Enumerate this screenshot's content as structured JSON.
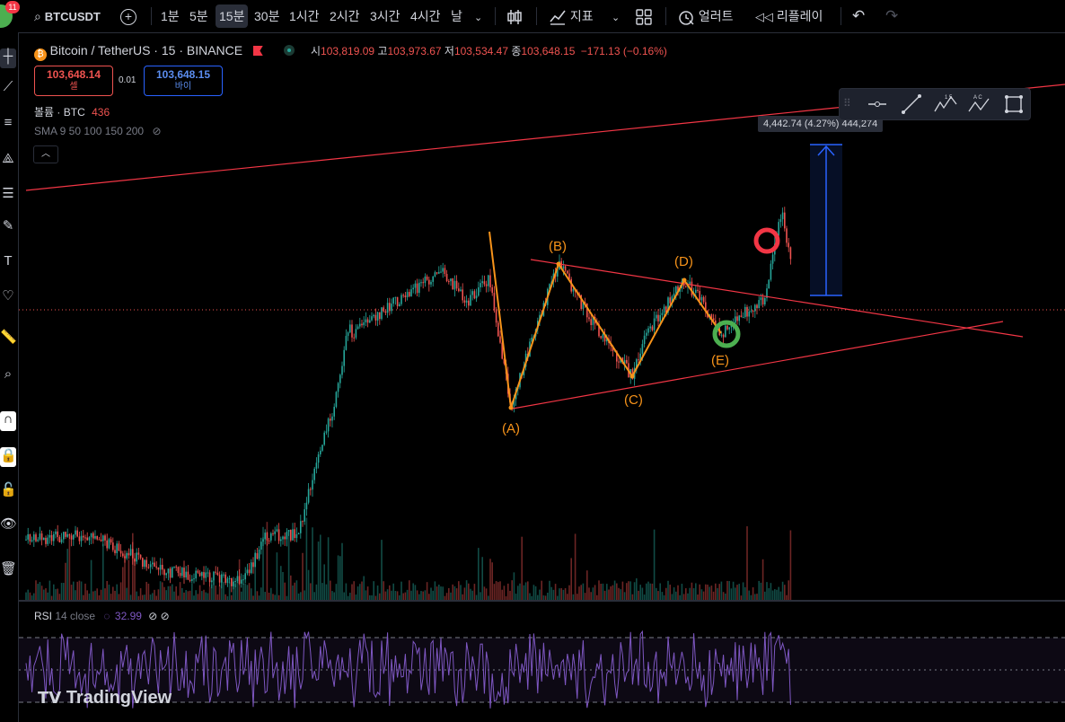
{
  "toolbar": {
    "notification_count": "11",
    "symbol": "BTCUSDT",
    "timeframes": [
      "1분",
      "5분",
      "15분",
      "30분",
      "1시간",
      "2시간",
      "3시간",
      "4시간",
      "날"
    ],
    "active_timeframe": "15분",
    "indicators_label": "지표",
    "alert_label": "얼러트",
    "replay_label": "리플레이"
  },
  "legend": {
    "title": "Bitcoin / TetherUS · 15 · BINANCE",
    "open_label": "시",
    "open": "103,819.09",
    "high_label": "고",
    "high": "103,973.67",
    "low_label": "저",
    "low": "103,534.47",
    "close_label": "종",
    "close": "103,648.15",
    "change": "−171.13 (−0.16%)",
    "sell_price": "103,648.14",
    "sell_label": "셀",
    "spread": "0.01",
    "buy_price": "103,648.15",
    "buy_label": "바이",
    "volume_label": "볼륨 · BTC",
    "volume_value": "436",
    "sma_label": "SMA 9 50 100 150 200"
  },
  "measure": {
    "text": "4,442.74 (4.27%) 444,274"
  },
  "wave_labels": [
    "(A)",
    "(B)",
    "(C)",
    "(D)",
    "(E)"
  ],
  "rsi": {
    "label": "RSI",
    "params": "14 close",
    "value": "32.99"
  },
  "branding": "TradingView",
  "colors": {
    "up": "#26a69a",
    "down": "#ef5350",
    "wave": "#f7931a",
    "trend": "#f23645",
    "measure": "#2962ff",
    "rsi": "#7e57c2",
    "circle_green": "#4caf50"
  }
}
